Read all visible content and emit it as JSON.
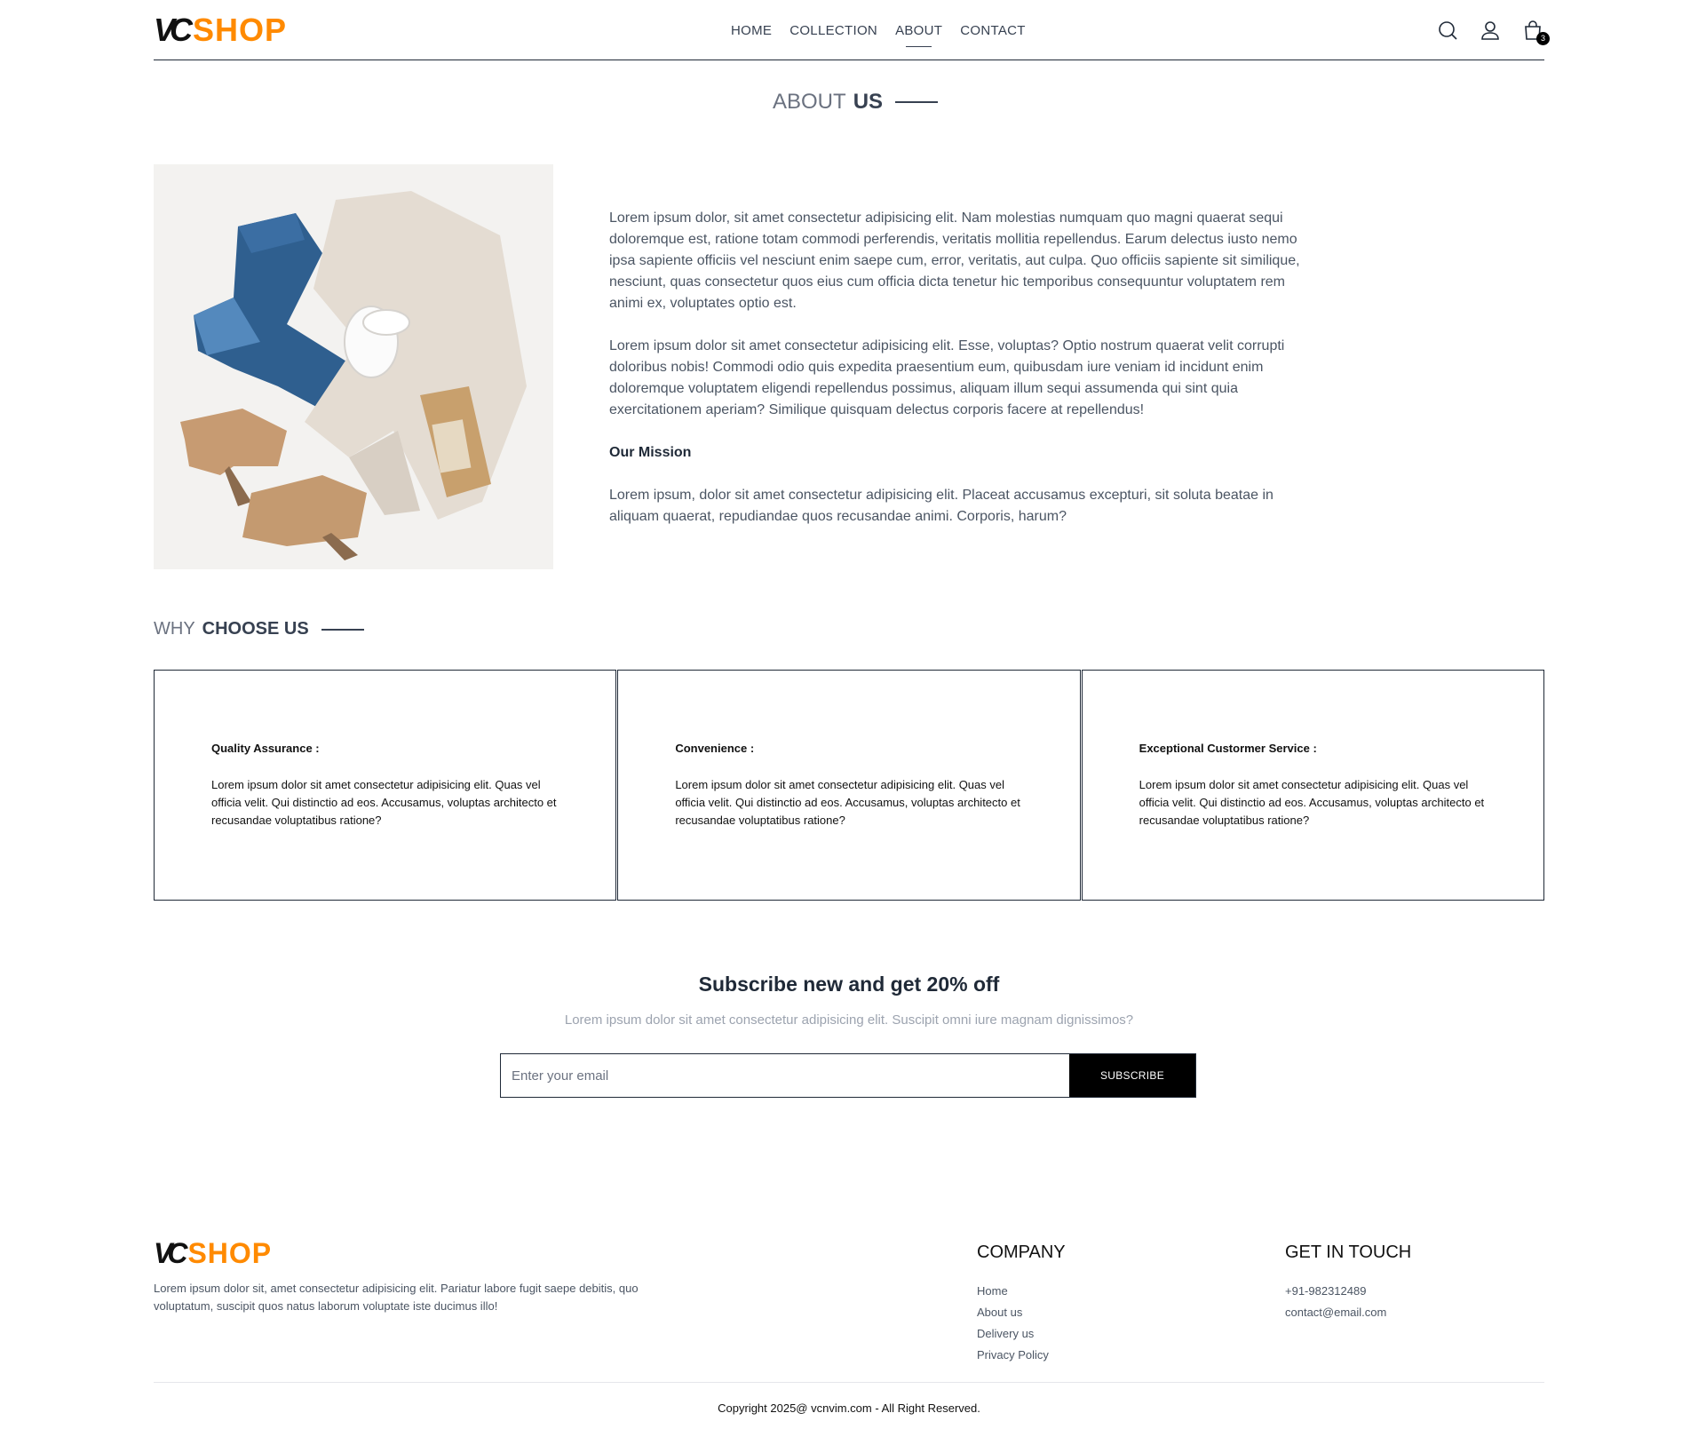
{
  "brand": {
    "prefix": "VC",
    "name": "SHOP",
    "accent_color": "#ff8a00"
  },
  "nav": {
    "items": [
      {
        "label": "HOME"
      },
      {
        "label": "COLLECTION"
      },
      {
        "label": "ABOUT"
      },
      {
        "label": "CONTACT"
      }
    ],
    "active": "ABOUT"
  },
  "header_icons": {
    "search": "search-icon",
    "profile": "user-icon",
    "cart": "shopping-bag-icon",
    "cart_count": "3"
  },
  "about": {
    "title_light": "ABOUT",
    "title_bold": "US",
    "image_name": "clothes-flatlay-image",
    "paragraph1": "Lorem ipsum dolor, sit amet consectetur adipisicing elit. Nam molestias numquam quo magni quaerat sequi doloremque est, ratione totam commodi perferendis, veritatis mollitia repellendus. Earum delectus iusto nemo ipsa sapiente officiis vel nesciunt enim saepe cum, error, veritatis, aut culpa. Quo officiis sapiente sit similique, nesciunt, quas consectetur quos eius cum officia dicta tenetur hic temporibus consequuntur voluptatem rem animi ex, voluptates optio est.",
    "paragraph2": "Lorem ipsum dolor sit amet consectetur adipisicing elit. Esse, voluptas? Optio nostrum quaerat velit corrupti doloribus nobis! Commodi odio quis expedita praesentium eum, quibusdam iure veniam id incidunt enim doloremque voluptatem eligendi repellendus possimus, aliquam illum sequi assumenda qui sint quia exercitationem aperiam? Similique quisquam delectus corporis facere at repellendus!",
    "mission_heading": "Our Mission",
    "mission_text": "Lorem ipsum, dolor sit amet consectetur adipisicing elit. Placeat accusamus excepturi, sit soluta beatae in aliquam quaerat, repudiandae quos recusandae animi. Corporis, harum?"
  },
  "why": {
    "title_light": "WHY",
    "title_bold": "CHOOSE US",
    "cards": [
      {
        "heading": "Quality Assurance :",
        "text": "Lorem ipsum dolor sit amet consectetur adipisicing elit. Quas vel officia velit. Qui distinctio ad eos. Accusamus, voluptas architecto et recusandae voluptatibus ratione?"
      },
      {
        "heading": "Convenience :",
        "text": "Lorem ipsum dolor sit amet consectetur adipisicing elit. Quas vel officia velit. Qui distinctio ad eos. Accusamus, voluptas architecto et recusandae voluptatibus ratione?"
      },
      {
        "heading": "Exceptional Custormer Service :",
        "text": "Lorem ipsum dolor sit amet consectetur adipisicing elit. Quas vel officia velit. Qui distinctio ad eos. Accusamus, voluptas architecto et recusandae voluptatibus ratione?"
      }
    ]
  },
  "subscribe": {
    "title": "Subscribe new and get 20% off",
    "description": "Lorem ipsum dolor sit amet consectetur adipisicing elit. Suscipit omni iure magnam dignissimos?",
    "placeholder": "Enter your email",
    "button": "SUBSCRIBE"
  },
  "footer": {
    "description": "Lorem ipsum dolor sit, amet consectetur adipisicing elit. Pariatur labore fugit saepe debitis, quo voluptatum, suscipit quos natus laborum voluptate iste ducimus illo!",
    "company_title": "COMPANY",
    "company_links": [
      "Home",
      "About us",
      "Delivery us",
      "Privacy Policy"
    ],
    "touch_title": "GET IN TOUCH",
    "phone": "+91-982312489",
    "email": "contact@email.com",
    "copyright": "Copyright 2025@ vcnvim.com - All Right Reserved."
  }
}
